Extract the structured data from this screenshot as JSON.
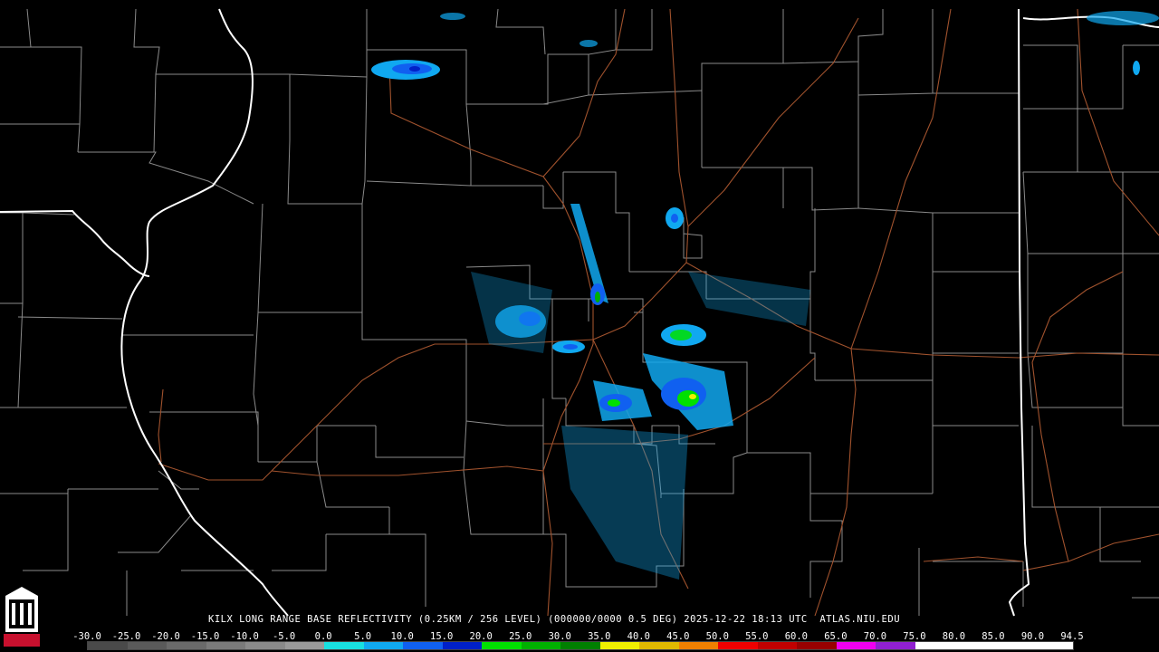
{
  "caption": "KILX LONG RANGE BASE REFLECTIVITY (0.25KM / 256 LEVEL) (000000/0000 0.5 DEG) 2025-12-22 18:13 UTC  ATLAS.NIU.EDU",
  "logo": {
    "text": "NIU",
    "color": "#c8102e"
  },
  "scale": {
    "labels": [
      "-30.0",
      "-25.0",
      "-20.0",
      "-15.0",
      "-10.0",
      "-5.0",
      "0.0",
      "5.0",
      "10.0",
      "15.0",
      "20.0",
      "25.0",
      "30.0",
      "35.0",
      "40.0",
      "45.0",
      "50.0",
      "55.0",
      "60.0",
      "65.0",
      "70.0",
      "75.0",
      "80.0",
      "85.0",
      "90.0",
      "94.5"
    ],
    "colors": [
      "#4a4a4a",
      "#5a5a5a",
      "#6a6a6a",
      "#7a7a7a",
      "#8a8a8a",
      "#9a9a9a",
      "#18e0e0",
      "#10a8f0",
      "#1060f0",
      "#0020c8",
      "#00e000",
      "#00b000",
      "#008000",
      "#f0f000",
      "#e0b800",
      "#f08000",
      "#f00000",
      "#c00000",
      "#980000",
      "#f000f0",
      "#9020d0",
      "#ffffff",
      "#ffffff",
      "#ffffff",
      "#ffffff"
    ]
  },
  "map": {
    "state_border_color": "#ffffff",
    "county_line_color": "#8a8a8a",
    "highway_color": "#a0522d"
  }
}
